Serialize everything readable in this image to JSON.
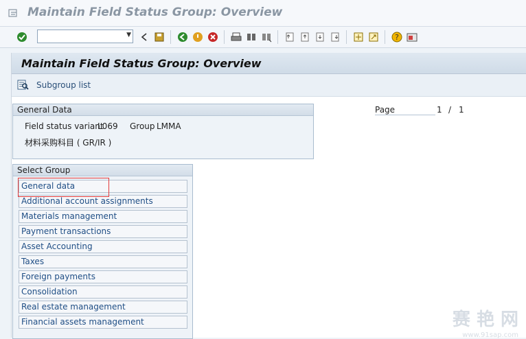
{
  "window": {
    "title": "Maintain Field Status Group: Overview"
  },
  "toolbar": {
    "command_field": {
      "value": "",
      "placeholder": ""
    },
    "buttons": [
      "enter-icon",
      "back-arrow-icon",
      "save-icon",
      "back-icon",
      "exit-icon",
      "cancel-icon",
      "print-icon",
      "find-icon",
      "find-next-icon",
      "first-page-icon",
      "previous-page-icon",
      "next-page-icon",
      "last-page-icon",
      "create-session-icon",
      "shortcut-icon",
      "help-icon",
      "customize-layout-icon"
    ]
  },
  "page": {
    "title": "Maintain Field Status Group: Overview",
    "app_toolbar": {
      "subgroup_list_label": "Subgroup list"
    },
    "general_data": {
      "header": "General Data",
      "variant_label": "Field status variant",
      "variant_value": "L069",
      "group_label": "Group",
      "group_value": "LMMA",
      "description": "材料采购科目 ( GR/IR )"
    },
    "pagination": {
      "label": "Page",
      "current": "1",
      "separator": "/",
      "total": "1"
    },
    "select_group": {
      "header": "Select Group",
      "items": [
        "General data",
        "Additional account assignments",
        "Materials management",
        "Payment transactions",
        "Asset Accounting",
        "Taxes",
        "Foreign payments",
        "Consolidation",
        "Real estate management",
        "Financial assets management"
      ]
    }
  },
  "watermark": {
    "text": "赛 艳 网",
    "sub": "www.91sap.com"
  }
}
